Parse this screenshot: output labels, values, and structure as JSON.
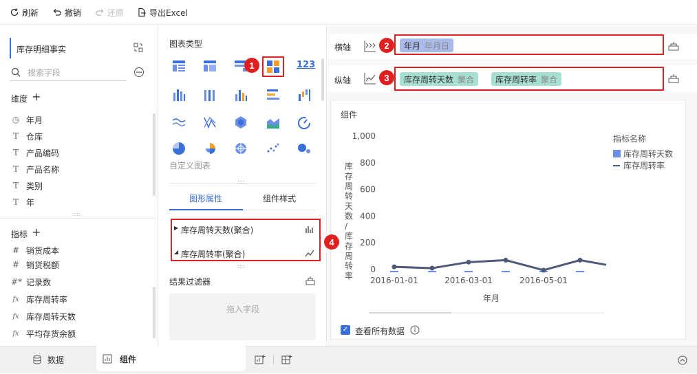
{
  "toolbar": {
    "refresh": "刷新",
    "undo": "撤销",
    "redo": "还原",
    "export": "导出Excel"
  },
  "left": {
    "dataset": "库存明细事实",
    "search_placeholder": "搜索字段",
    "dimensions_title": "维度",
    "dimensions": [
      {
        "icon": "clock-icon",
        "label": "年月"
      },
      {
        "icon": "text-icon",
        "label": "仓库"
      },
      {
        "icon": "text-icon",
        "label": "产品编码"
      },
      {
        "icon": "text-icon",
        "label": "产品名称"
      },
      {
        "icon": "text-icon",
        "label": "类别"
      },
      {
        "icon": "text-icon",
        "label": "年"
      }
    ],
    "measures_title": "指标",
    "measures": [
      {
        "icon": "hash-icon",
        "label": "销货成本"
      },
      {
        "icon": "hash-icon",
        "label": "销货税额"
      },
      {
        "icon": "hash-star-icon",
        "label": "记录数"
      },
      {
        "icon": "fx-icon",
        "label": "库存周转率"
      },
      {
        "icon": "fx-icon",
        "label": "库存周转天数"
      },
      {
        "icon": "fx-icon",
        "label": "平均存货余额"
      }
    ]
  },
  "mid": {
    "chart_types_title": "图表类型",
    "custom_chart": "自定义图表",
    "tab_props": "图形属性",
    "tab_style": "组件样式",
    "props": [
      {
        "label": "库存周转天数(聚合)",
        "icon": "bar-chart-icon"
      },
      {
        "label": "库存周转率(聚合)",
        "icon": "line-chart-icon"
      }
    ],
    "filter_title": "结果过滤器",
    "drop_hint": "拖入字段",
    "kpi_label": "123"
  },
  "right": {
    "x_axis_label": "横轴",
    "y_axis_label": "纵轴",
    "x_pill": {
      "name": "年月",
      "sub": "年月日"
    },
    "y_pills": [
      {
        "name": "库存周转天数",
        "sub": "聚合"
      },
      {
        "name": "库存周转率",
        "sub": "聚合"
      }
    ],
    "component_title": "组件",
    "show_all": "查看所有数据"
  },
  "badges": [
    "1",
    "2",
    "3",
    "4"
  ],
  "bottom": {
    "data_tab": "数据",
    "component_tab": "组件"
  },
  "chart_data": {
    "type": "line",
    "ylabel": "库存周转天数/库存周转率",
    "xlabel": "年月",
    "yticks": [
      "1,000",
      "800",
      "600",
      "400",
      "200",
      "0"
    ],
    "xticks": [
      "2016-01-01",
      "2016-03-01",
      "2016-05-01"
    ],
    "legend_title": "指标名称",
    "series": [
      {
        "name": "库存周转天数",
        "values": [
          0,
          0,
          0,
          0,
          0,
          0,
          0,
          0,
          0
        ]
      },
      {
        "name": "库存周转率",
        "values": [
          20,
          10,
          55,
          70,
          -5,
          70,
          35
        ]
      }
    ],
    "ylim": [
      0,
      1000
    ],
    "colors": {
      "bar": "#6b8ee6",
      "line": "#4e5a78"
    }
  }
}
